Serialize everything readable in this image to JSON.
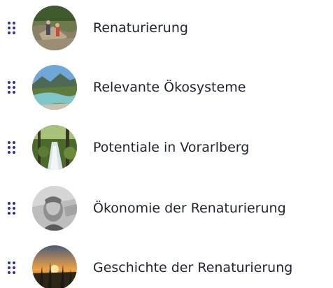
{
  "topics": [
    {
      "label": "Renaturierung",
      "thumbnail": "river-restoration-photo",
      "handle_icon": "drag-handle-icon"
    },
    {
      "label": "Relevante Ökosysteme",
      "thumbnail": "mountain-river-photo",
      "handle_icon": "drag-handle-icon"
    },
    {
      "label": "Potentiale in Vorarlberg",
      "thumbnail": "forest-stream-photo",
      "handle_icon": "drag-handle-icon"
    },
    {
      "label": "Ökonomie der Renaturierung",
      "thumbnail": "banknote-portrait-photo",
      "handle_icon": "drag-handle-icon"
    },
    {
      "label": "Geschichte der Renaturierung",
      "thumbnail": "sunset-meadow-photo",
      "handle_icon": "drag-handle-icon"
    }
  ],
  "colors": {
    "handle": "#2b2fa3",
    "text": "#1f2333"
  }
}
